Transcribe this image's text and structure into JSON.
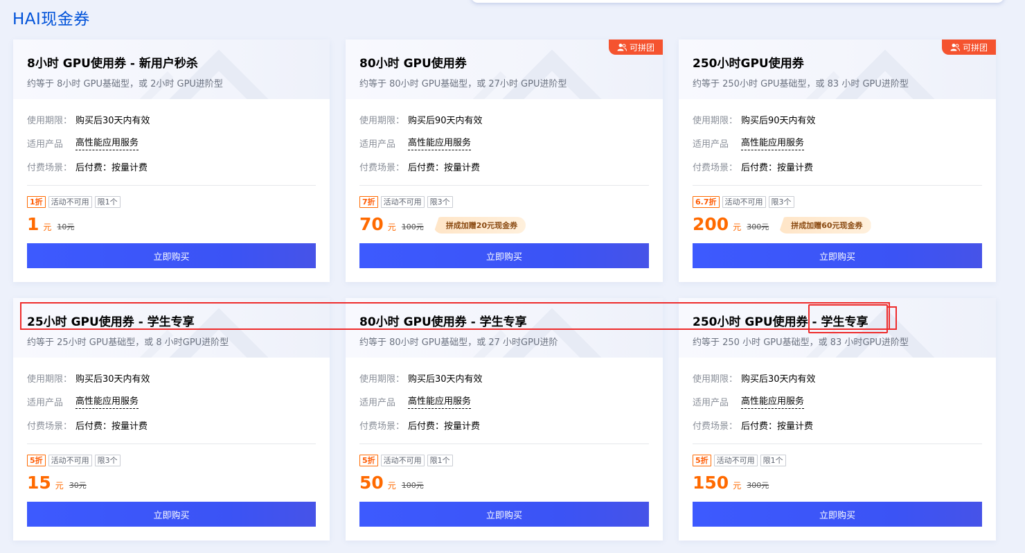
{
  "page": {
    "title": "HAI现金券"
  },
  "cards": [
    {
      "title": "8小时 GPU使用券 - 新用户秒杀",
      "subtitle": "约等于 8小时 GPU基础型，或 2小时 GPU进阶型",
      "badge": "",
      "validity_label": "使用期限：",
      "validity": "购买后30天内有效",
      "product_label": "适用产品",
      "product": "高性能应用服务",
      "billing_label": "付费场景：",
      "billing": "后付费：按量计费",
      "discount": "1折",
      "tag_activity": "活动不可用",
      "tag_limit": "限1个",
      "price": "1",
      "unit": "元",
      "original_price": "10元",
      "promo": "",
      "buy_label": "立即购买"
    },
    {
      "title": "80小时 GPU使用券",
      "subtitle": "约等于 80小时 GPU基础型，或 27小时 GPU进阶型",
      "badge": "可拼团",
      "validity_label": "使用期限：",
      "validity": "购买后90天内有效",
      "product_label": "适用产品",
      "product": "高性能应用服务",
      "billing_label": "付费场景：",
      "billing": "后付费：按量计费",
      "discount": "7折",
      "tag_activity": "活动不可用",
      "tag_limit": "限3个",
      "price": "70",
      "unit": "元",
      "original_price": "100元",
      "promo": "拼成加赠20元现金券",
      "buy_label": "立即购买"
    },
    {
      "title": "250小时GPU使用券",
      "subtitle": "约等于 250小时 GPU基础型，或 83 小时 GPU进阶型",
      "badge": "可拼团",
      "validity_label": "使用期限：",
      "validity": "购买后90天内有效",
      "product_label": "适用产品",
      "product": "高性能应用服务",
      "billing_label": "付费场景：",
      "billing": "后付费：按量计费",
      "discount": "6.7折",
      "tag_activity": "活动不可用",
      "tag_limit": "限3个",
      "price": "200",
      "unit": "元",
      "original_price": "300元",
      "promo": "拼成加赠60元现金券",
      "buy_label": "立即购买"
    },
    {
      "title": "25小时 GPU使用券 - 学生专享",
      "subtitle": "约等于 25小时 GPU基础型，或 8 小时GPU进阶型",
      "badge": "",
      "validity_label": "使用期限：",
      "validity": "购买后30天内有效",
      "product_label": "适用产品",
      "product": "高性能应用服务",
      "billing_label": "付费场景：",
      "billing": "后付费：按量计费",
      "discount": "5折",
      "tag_activity": "活动不可用",
      "tag_limit": "限3个",
      "price": "15",
      "unit": "元",
      "original_price": "30元",
      "promo": "",
      "buy_label": "立即购买"
    },
    {
      "title": "80小时 GPU使用券 - 学生专享",
      "subtitle": "约等于 80小时 GPU基础型，或 27 小时GPU进阶",
      "badge": "",
      "validity_label": "使用期限：",
      "validity": "购买后30天内有效",
      "product_label": "适用产品",
      "product": "高性能应用服务",
      "billing_label": "付费场景：",
      "billing": "后付费：按量计费",
      "discount": "5折",
      "tag_activity": "活动不可用",
      "tag_limit": "限1个",
      "price": "50",
      "unit": "元",
      "original_price": "100元",
      "promo": "",
      "buy_label": "立即购买"
    },
    {
      "title": "250小时 GPU使用券 - 学生专享",
      "subtitle": "约等于 250 小时 GPU基础型，或 83 小时GPU进阶型",
      "badge": "",
      "validity_label": "使用期限：",
      "validity": "购买后30天内有效",
      "product_label": "适用产品",
      "product": "高性能应用服务",
      "billing_label": "付费场景：",
      "billing": "后付费：按量计费",
      "discount": "5折",
      "tag_activity": "活动不可用",
      "tag_limit": "限1个",
      "price": "150",
      "unit": "元",
      "original_price": "300元",
      "promo": "",
      "buy_label": "立即购买"
    }
  ],
  "colors": {
    "accent": "#0052d9",
    "price": "#ff6a00",
    "button": "#3d5afe",
    "badge": "#f5532f",
    "annotation": "#ee2b2b"
  }
}
